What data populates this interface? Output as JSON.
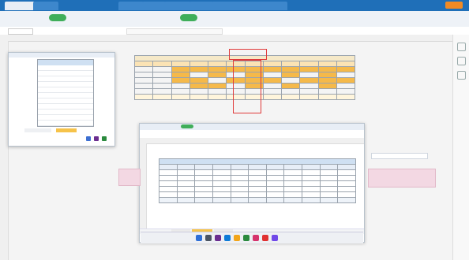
{
  "window": {
    "tabs": [
      "",
      "",
      "",
      "",
      "",
      "",
      "",
      ""
    ]
  },
  "ribbon": {
    "items": [
      "",
      "",
      "",
      "",
      "",
      "",
      "",
      ""
    ]
  },
  "main_table": {
    "title": "",
    "headers": [
      "",
      "",
      "",
      "",
      "",
      "",
      "",
      "",
      "",
      "",
      "",
      ""
    ],
    "rows": [
      [
        "",
        "",
        "",
        "",
        "",
        "",
        "",
        "",
        "",
        "",
        "",
        ""
      ],
      [
        "",
        "",
        "",
        "",
        "",
        "",
        "",
        "",
        "",
        "",
        "",
        ""
      ],
      [
        "",
        "",
        "",
        "",
        "",
        "",
        "",
        "",
        "",
        "",
        "",
        ""
      ],
      [
        "",
        "",
        "",
        "",
        "",
        "",
        "",
        "",
        "",
        "",
        "",
        ""
      ],
      [
        "",
        "",
        "",
        "",
        "",
        "",
        "",
        "",
        "",
        "",
        "",
        ""
      ],
      [
        "",
        "",
        "",
        "",
        "",
        "",
        "",
        "",
        "",
        "",
        "",
        ""
      ]
    ]
  },
  "lower_table": {
    "title": "",
    "headers": [
      "",
      "",
      "",
      "",
      "",
      "",
      "",
      "",
      "",
      "",
      ""
    ],
    "rows": [
      [
        "",
        "",
        "",
        "",
        "",
        "",
        "",
        "",
        "",
        "",
        ""
      ],
      [
        "",
        "",
        "",
        "",
        "",
        "",
        "",
        "",
        "",
        "",
        ""
      ],
      [
        "",
        "",
        "",
        "",
        "",
        "",
        "",
        "",
        "",
        "",
        ""
      ],
      [
        "",
        "",
        "",
        "",
        "",
        "",
        "",
        "",
        "",
        "",
        ""
      ],
      [
        "",
        "",
        "",
        "",
        "",
        "",
        "",
        "",
        "",
        "",
        ""
      ],
      [
        "",
        "",
        "",
        "",
        "",
        "",
        "",
        "",
        "",
        "",
        ""
      ]
    ]
  },
  "colors": {
    "tabstrip": "#1f6fb8",
    "header_orange": "#f5b94a",
    "highlight_red": "#e03a3a",
    "accent_green": "#3fae5a"
  }
}
